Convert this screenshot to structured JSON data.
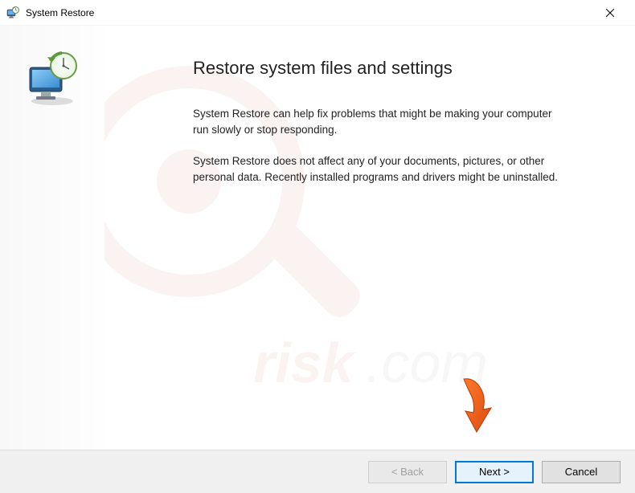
{
  "window": {
    "title": "System Restore"
  },
  "content": {
    "headline": "Restore system files and settings",
    "para1": "System Restore can help fix problems that might be making your computer run slowly or stop responding.",
    "para2": "System Restore does not affect any of your documents, pictures, or other personal data. Recently installed programs and drivers might be uninstalled."
  },
  "buttons": {
    "back": "< Back",
    "next": "Next >",
    "cancel": "Cancel"
  }
}
